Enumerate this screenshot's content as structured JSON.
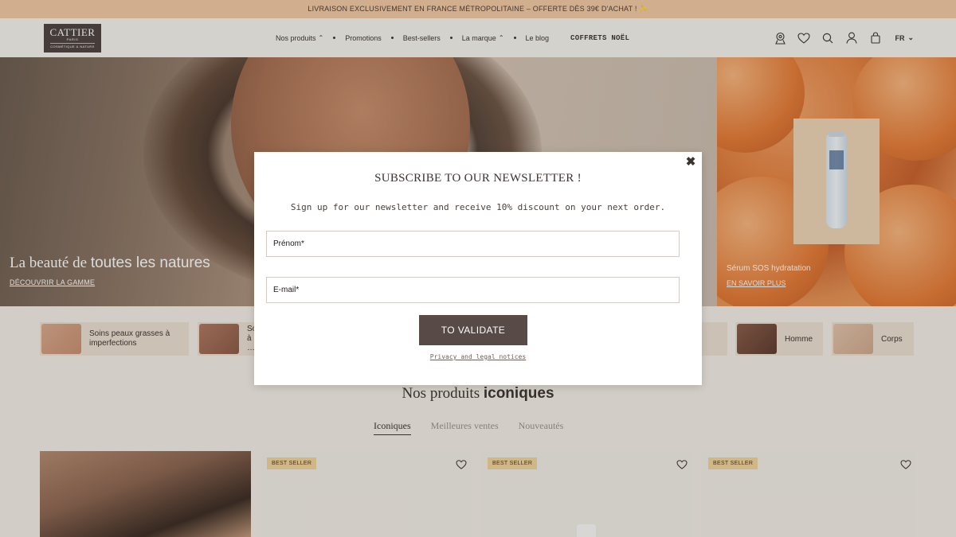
{
  "promo": {
    "text": "LIVRAISON EXCLUSIVEMENT EN FRANCE MÉTROPOLITAINE – OFFERTE DÈS 39€ D'ACHAT ! ✨"
  },
  "header": {
    "logo": {
      "name": "CATTIER",
      "sub": "PARIS",
      "tagline": "COSMÉTIQUE & NATURE"
    },
    "nav": [
      {
        "label": "Nos produits",
        "caret": "⌃"
      },
      {
        "label": "Promotions"
      },
      {
        "label": "Best-sellers"
      },
      {
        "label": "La marque",
        "caret": "⌃"
      },
      {
        "label": "Le blog"
      },
      {
        "label": "COFFRETS NOËL"
      }
    ],
    "icons": [
      "store-locator-icon",
      "wishlist-icon",
      "search-icon",
      "account-icon",
      "cart-icon"
    ],
    "language": "FR",
    "language_caret": "⌄"
  },
  "hero": {
    "left": {
      "title_start": "La beauté de ",
      "title_bold": "toutes les natures",
      "link": "DÉCOUVRIR LA GAMME"
    },
    "right": {
      "title": "Sérum SOS hydratation",
      "link": "EN SAVOIR PLUS"
    }
  },
  "categories": [
    {
      "label": "Soins peaux grasses à imperfections"
    },
    {
      "label": "So… à …"
    },
    {
      "label": "Homme"
    },
    {
      "label": "Corps"
    }
  ],
  "iconic": {
    "title_start": "Nos produits ",
    "title_bold": "iconiques",
    "tabs": [
      "Iconiques",
      "Meilleures ventes",
      "Nouveautés"
    ],
    "badge": "BEST SELLER"
  },
  "modal": {
    "title": "SUBSCRIBE TO OUR NEWSLETTER !",
    "subtitle": "Sign up for our newsletter and receive 10% discount on your next order.",
    "firstname_placeholder": "Prénom*",
    "email_placeholder": "E-mail*",
    "submit": "TO VALIDATE",
    "legal": "Privacy and legal notices",
    "close": "✖"
  },
  "colors": {
    "promo_bg": "#f2c9a4",
    "brand_dark": "#574a47",
    "badge_bg": "#f2d39a",
    "page_bg": "#f3eee8"
  }
}
